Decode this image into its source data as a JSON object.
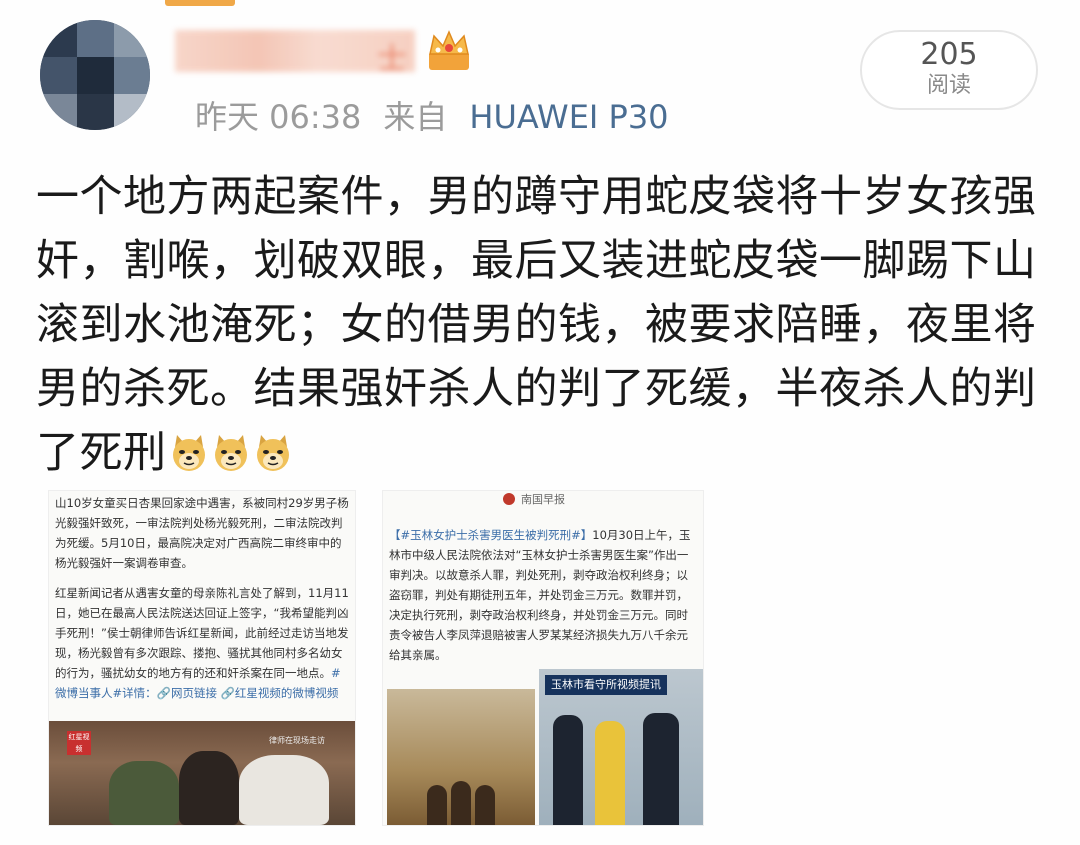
{
  "header": {
    "timestamp": "昨天 06:38",
    "source_prefix": "来自",
    "device": "HUAWEI P30",
    "username_glyph": "士"
  },
  "read_counter": {
    "count": "205",
    "label": "阅读"
  },
  "post": {
    "text": "一个地方两起案件，男的蹲守用蛇皮袋将十岁女孩强奸，割喉，划破双眼，最后又装进蛇皮袋一脚踢下山滚到水池淹死；女的借男的钱，被要求陪睡，夜里将男的杀死。结果强奸杀人的判了死缓，半夜杀人的判了死刑",
    "emoji_count": 3,
    "emoji_name": "doge-emoji"
  },
  "left_image": {
    "top_text": "山10岁女童买日杏果回家途中遇害，系被同村29岁男子杨光毅强奸致死，一审法院判处杨光毅死刑，二审法院改判为死缓。5月10日，最高院决定对广西高院二审终审中的杨光毅强奸一案调卷审查。",
    "para2_a": "红星新闻记者从遇害女童的母亲陈礼言处了解到，11月11日，她已在最高人民法院送达回证上签字，“我希望能判凶手死刑！”侯士朝律师告诉红星新闻，此前经过走访当地发现，杨光毅曾有多次跟踪、搂抱、骚扰其他同村多名幼女的行为，骚扰幼女的地方有的还和奸杀案在同一地点。",
    "hashtag": "#微博当事人#",
    "link_text": "详情：🔗网页链接 🔗红星视频的微博视频",
    "video_badge": "红星视频",
    "photo_caption": "律师在现场走访"
  },
  "right_image": {
    "outlet": "南国早报",
    "hashtag": "【#玉林女护士杀害男医生被判死刑#】",
    "body": "10月30日上午，玉林市中级人民法院依法对“玉林女护士杀害男医生案”作出一审判决。以故意杀人罪，判处死刑，剥夺政治权利终身；以盗窃罪，判处有期徒刑五年，并处罚金三万元。数罪并罚，决定执行死刑，剥夺政治权利终身，并处罚金三万元。同时责令被告人李凤萍退赔被害人罗某某经济损失九万八千余元给其亲属。",
    "banner": "玉林市看守所视频提讯"
  }
}
